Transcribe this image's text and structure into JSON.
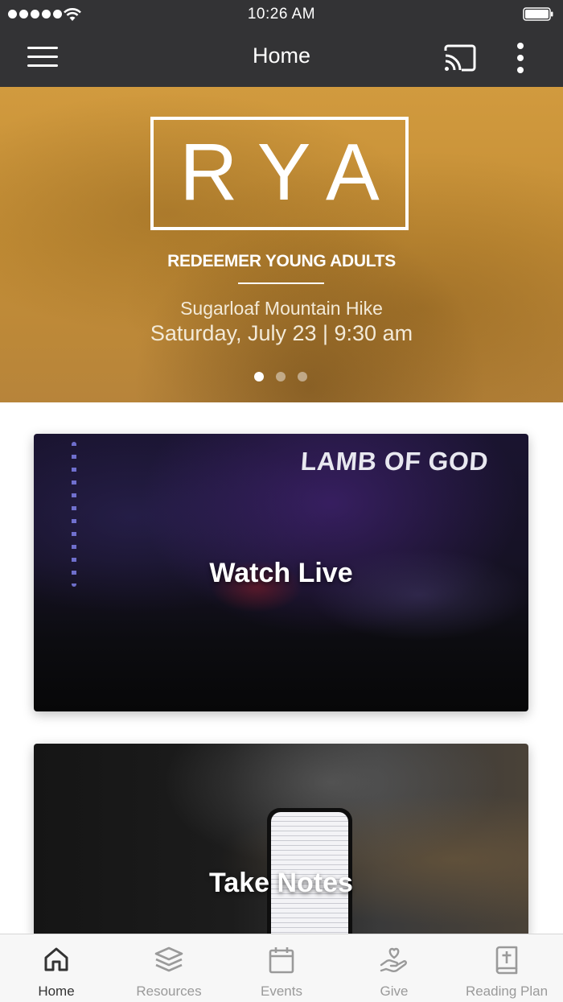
{
  "status_bar": {
    "time": "10:26 AM"
  },
  "navbar": {
    "title": "Home"
  },
  "hero": {
    "logo": "RYA",
    "subtitle": "REDEEMER YOUNG ADULTS",
    "event_name": "Sugarloaf Mountain Hike",
    "event_date": "Saturday, July 23 | 9:30 am",
    "slide_count": 3,
    "active_slide": 1
  },
  "cards": {
    "watch_live": {
      "label": "Watch Live",
      "sign_text": "LAMB OF GOD"
    },
    "take_notes": {
      "label": "Take Notes"
    }
  },
  "tabbar": {
    "tabs": [
      {
        "label": "Home",
        "icon": "home-icon",
        "active": true
      },
      {
        "label": "Resources",
        "icon": "layers-icon",
        "active": false
      },
      {
        "label": "Events",
        "icon": "calendar-icon",
        "active": false
      },
      {
        "label": "Give",
        "icon": "hand-heart-icon",
        "active": false
      },
      {
        "label": "Reading Plan",
        "icon": "bible-icon",
        "active": false
      }
    ]
  },
  "colors": {
    "bar_background": "#333335",
    "hero_gold": "#c48e36",
    "tab_active": "#333333",
    "tab_inactive": "#9a9a9a"
  }
}
